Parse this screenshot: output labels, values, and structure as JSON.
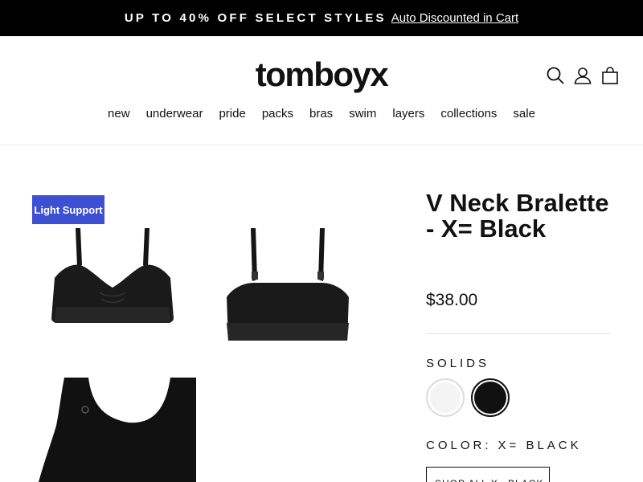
{
  "announcement": {
    "promo_text": "UP TO 40% OFF SELECT STYLES",
    "link_text": "Auto Discounted in Cart"
  },
  "header": {
    "logo": "tomboyx",
    "icons": [
      "search-icon",
      "account-icon",
      "cart-icon"
    ]
  },
  "nav": {
    "items": [
      "new",
      "underwear",
      "pride",
      "packs",
      "bras",
      "swim",
      "layers",
      "collections",
      "sale"
    ]
  },
  "gallery": {
    "badge": "Light Support"
  },
  "product": {
    "title": "V Neck Bralette - X= Black",
    "price": "$38.00",
    "swatch_group_label": "SOLIDS",
    "color_label": "COLOR:",
    "color_value": "X= BLACK",
    "shop_all_label": "SHOP ALL X= BLACK"
  },
  "colors": {
    "announcement_bg": "#000000",
    "badge_bg": "#3d4fd3",
    "text": "#111111"
  }
}
